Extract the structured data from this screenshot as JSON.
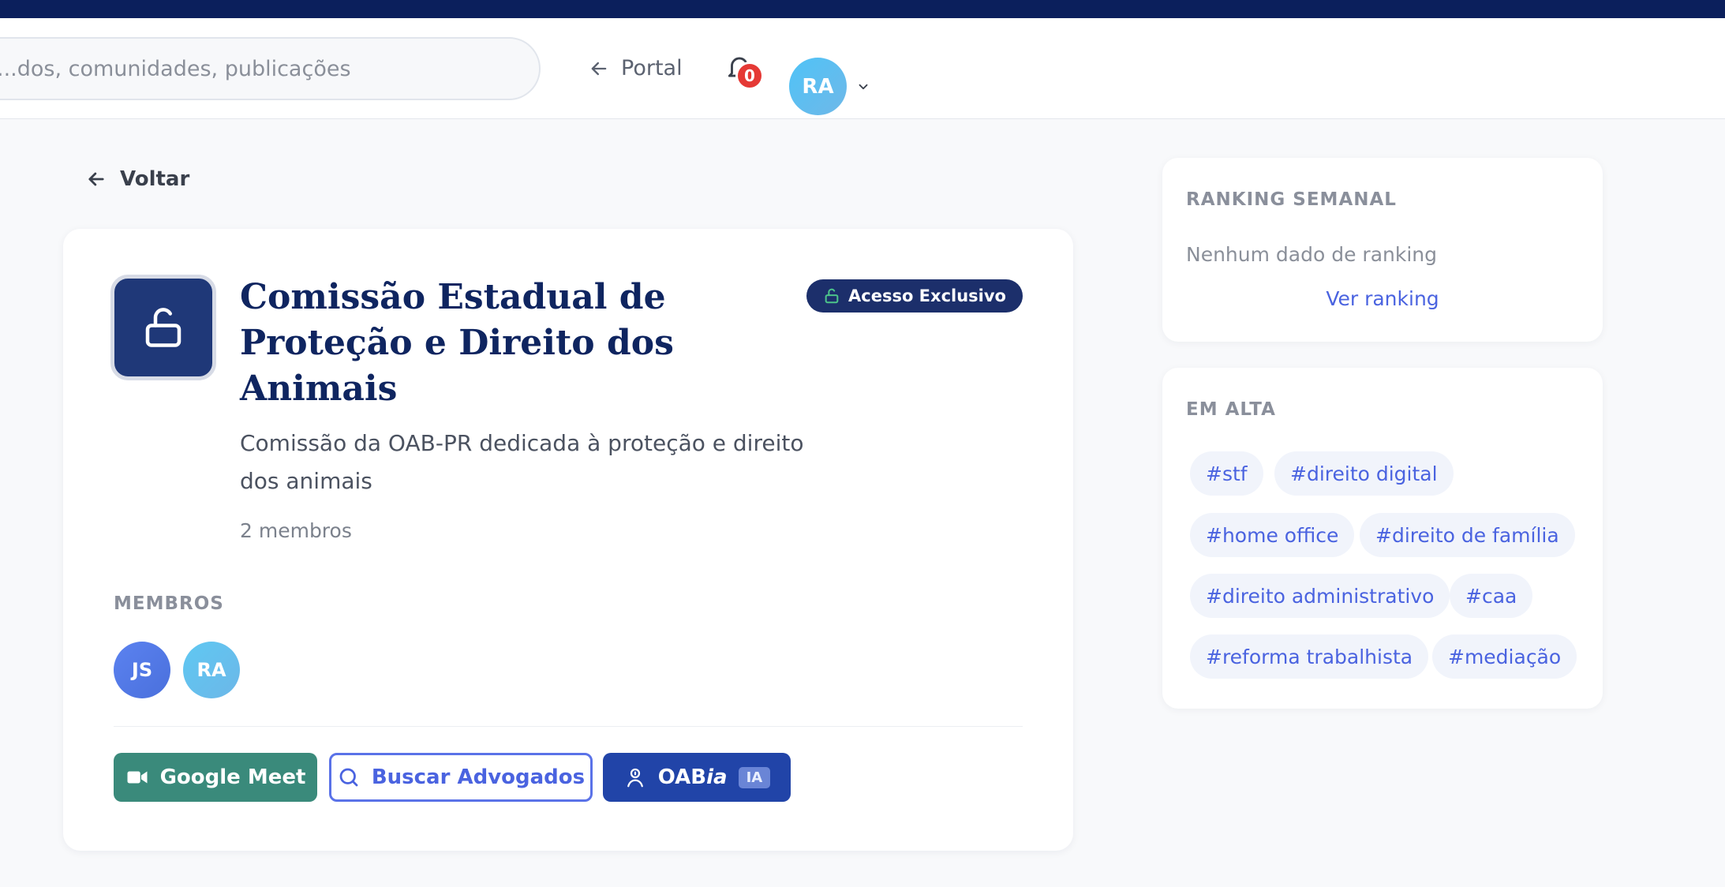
{
  "header": {
    "search_placeholder": "dos, comunidades, publicações...",
    "portal_label": "Portal",
    "notification_count": "0",
    "user_initials": "RA"
  },
  "back_label": "Voltar",
  "group": {
    "title": "Comissão Estadual de Proteção e Direito dos Animais",
    "badge": "Acesso Exclusivo",
    "description": "Comissão da OAB-PR dedicada à proteção e direito dos animais",
    "members_count": "2 membros",
    "members_label": "MEMBROS",
    "members": [
      "JS",
      "RA"
    ],
    "actions": {
      "meet": "Google Meet",
      "search": "Buscar Advogados",
      "oab_prefix": "OAB",
      "oab_suffix": "ia",
      "ia_chip": "IA"
    }
  },
  "ranking": {
    "title": "RANKING SEMANAL",
    "empty": "Nenhum dado de ranking",
    "link": "Ver ranking"
  },
  "trending": {
    "title": "EM ALTA",
    "tags": [
      "#stf",
      "#direito digital",
      "#home office",
      "#direito de família",
      "#direito administrativo",
      "#caa",
      "#reforma trabalhista",
      "#mediação"
    ]
  },
  "colors": {
    "navy": "#0b1f5c",
    "accent": "#4a63e0",
    "meet_green": "#3a8a7b",
    "badge_red": "#e53935"
  }
}
